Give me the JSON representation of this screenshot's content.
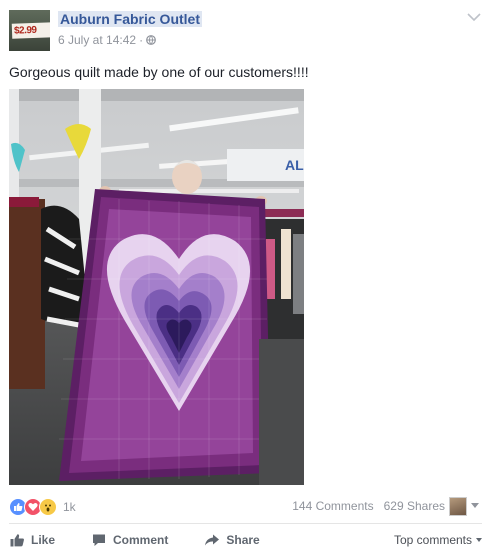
{
  "post": {
    "page_name": "Auburn Fabric Outlet",
    "avatar_text": "$2.99",
    "timestamp": "6 July at 14:42",
    "separator": "·",
    "caption": "Gorgeous quilt made by one of our customers!!!!",
    "store_sign": "AL"
  },
  "stats": {
    "reaction_count": "1k",
    "comments": "144 Comments",
    "shares": "629 Shares"
  },
  "actions": {
    "like": "Like",
    "comment": "Comment",
    "share": "Share",
    "sort": "Top comments"
  },
  "colors": {
    "link": "#365899",
    "muted": "#90949c",
    "like_blue": "#5890ff",
    "love_red": "#f25268",
    "wow_yellow": "#f7c947"
  },
  "icons": {
    "globe": "globe-icon",
    "chevron": "chevron-down-icon",
    "like": "thumbs-up-icon",
    "comment": "speech-bubble-icon",
    "share": "share-arrow-icon"
  }
}
